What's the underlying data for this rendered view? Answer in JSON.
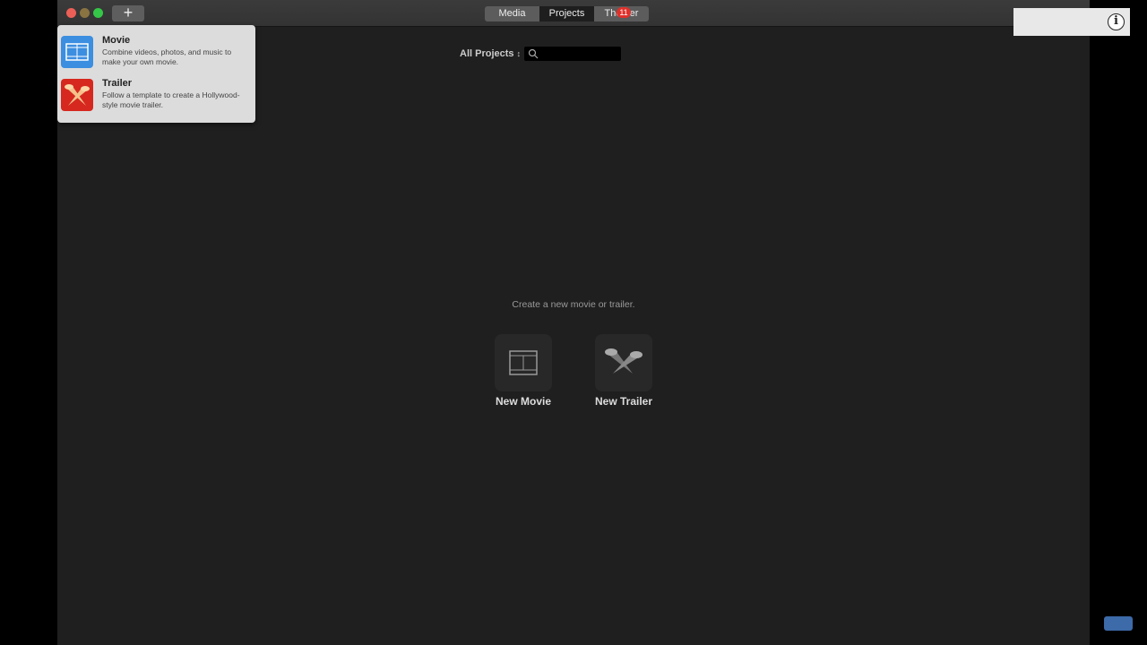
{
  "toolbar": {
    "add_label": "+",
    "tabs": [
      {
        "label": "Media"
      },
      {
        "label": "Projects",
        "active": true
      },
      {
        "label": "Theater"
      }
    ],
    "theater_badge": "11"
  },
  "filter": {
    "label": "All Projects",
    "search_placeholder": ""
  },
  "main": {
    "hint": "Create a new movie or trailer.",
    "new_movie": "New Movie",
    "new_trailer": "New Trailer"
  },
  "popup": {
    "items": [
      {
        "title": "Movie",
        "desc": "Combine videos, photos, and music to make your own movie."
      },
      {
        "title": "Trailer",
        "desc": "Follow a template to create a Hollywood-style movie trailer."
      }
    ]
  },
  "colors": {
    "close": "#ec5f57",
    "minimize": "#8a7441",
    "zoom": "#35c748",
    "badge": "#e0302a",
    "movie_icon": "#3b8ee0",
    "trailer_icon": "#d6281f"
  }
}
